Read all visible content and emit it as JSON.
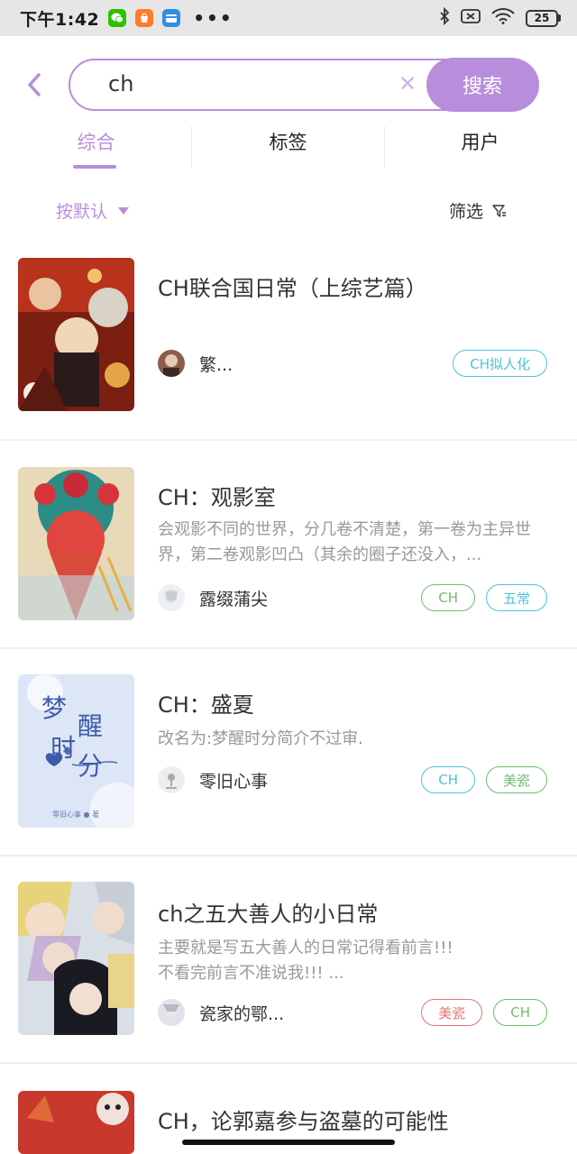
{
  "status_bar": {
    "time": "下午1:42",
    "battery": "25"
  },
  "search": {
    "query": "ch",
    "button_label": "搜索"
  },
  "tabs": [
    {
      "label": "综合",
      "active": true
    },
    {
      "label": "标签",
      "active": false
    },
    {
      "label": "用户",
      "active": false
    }
  ],
  "sort": {
    "label": "按默认"
  },
  "filter": {
    "label": "筛选"
  },
  "results": [
    {
      "title": "CH联合国日常（上综艺篇）",
      "description": "",
      "author": "繁...",
      "tags": [
        {
          "label": "CH拟人化",
          "color": "#4cc3d9"
        }
      ]
    },
    {
      "title": "CH：观影室",
      "description": "会观影不同的世界，分几卷不清楚，第一卷为主异世界，第二卷观影凹凸（其余的圈子还没入，...",
      "author": "露缀蒲尖",
      "tags": [
        {
          "label": "CH",
          "color": "#6cbf6c"
        },
        {
          "label": "五常",
          "color": "#4cc3d9"
        }
      ]
    },
    {
      "title": "CH：盛夏",
      "description": "改名为:梦醒时分简介不过审.",
      "author": "零旧心事",
      "cover_text": [
        "梦",
        "醒",
        "时",
        "分"
      ],
      "cover_caption": "零旧心事 ● 著",
      "tags": [
        {
          "label": "CH",
          "color": "#4cc3d9"
        },
        {
          "label": "美瓷",
          "color": "#6cbf6c"
        }
      ]
    },
    {
      "title": "ch之五大善人的小日常",
      "description": "主要就是写五大善人的日常记得看前言!!!\n不看完前言不准说我!!! ...",
      "author": "瓷家的鄂...",
      "tags": [
        {
          "label": "美瓷",
          "color": "#e57373"
        },
        {
          "label": "CH",
          "color": "#6cbf6c"
        }
      ]
    },
    {
      "title": "CH，论郭嘉参与盗墓的可能性",
      "description": "",
      "author": "",
      "tags": []
    }
  ],
  "colors": {
    "accent": "#b88ddb"
  }
}
